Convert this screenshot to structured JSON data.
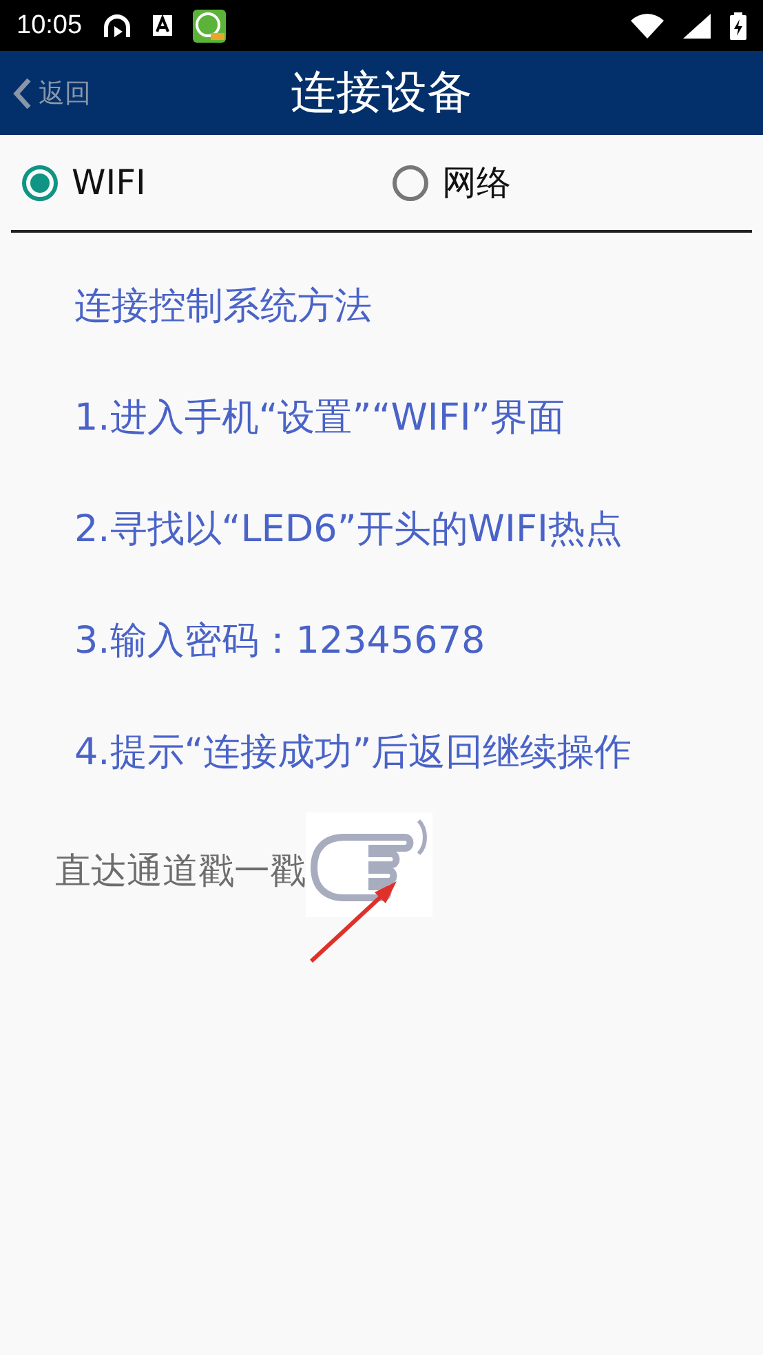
{
  "status_bar": {
    "time": "10:05"
  },
  "header": {
    "back": "返回",
    "title": "连接设备"
  },
  "modes": [
    {
      "label": "WIFI",
      "selected": true
    },
    {
      "label": "网络",
      "selected": false
    }
  ],
  "instructions": [
    "连接控制系统方法",
    "1.进入手机“设置”“WIFI”界面",
    "2.寻找以“LED6”开头的WIFI热点",
    "3.输入密码：12345678",
    "4.提示“连接成功”后返回继续操作"
  ],
  "shortcut": {
    "label": "直达通道戳一戳"
  }
}
